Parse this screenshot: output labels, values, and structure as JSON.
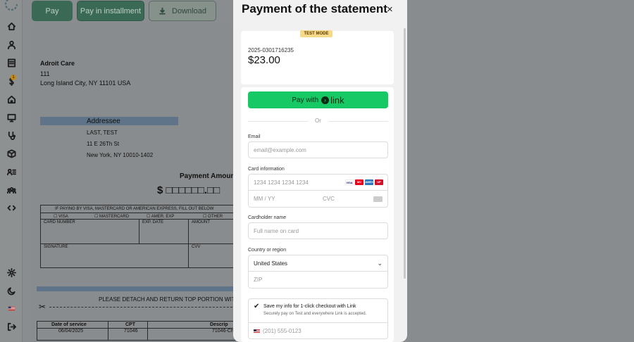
{
  "toolbar": {
    "pay_label": "Pay",
    "installment_label": "Pay in installment",
    "download_label": "Download"
  },
  "sidebar": {
    "badge_count": "1",
    "icons": [
      "home-icon",
      "user-icon",
      "document-icon",
      "dollar-icon",
      "house-icon",
      "monitor-icon",
      "stethoscope-icon",
      "box-icon",
      "user-list-icon",
      "group-icon",
      "code-icon",
      "settings-icon",
      "moon-icon",
      "us-flag-icon",
      "logout-icon"
    ]
  },
  "statement": {
    "company": "Adroit Care",
    "company_line2": "111",
    "company_line3": "Long Island City, NY 11101 USA",
    "addressee_header": "Addressee",
    "addressee_name": "LAST, TEST",
    "addressee_line2": "11 E 26Th St",
    "addressee_line3": "New York, NY 10010-1402",
    "payment_amount_label": "Payment Amoun",
    "amount_boxes": "$ □□□□□□.□□",
    "card_header": "IF PAYING BY VISA, MASTERCARD OR AMERICAN EXPRESS, FILL OUT BELOW",
    "card_visa": "☐ VISA",
    "card_mc": "☐ MASTERCARD",
    "card_amex": "☐ AMER. EXP",
    "card_other": "☐ OTHER",
    "card_number": "CARD NUMBER",
    "exp_date": "EXP. DATE",
    "amount": "AMOUNT",
    "signature": "SIGNATURE",
    "cvv": "CVV",
    "detach": "PLEASE DETACH AND RETURN TOP PORTION WITH YO",
    "col_date": "Date of service",
    "col_cpt": "CPT",
    "col_desc": "Descrip",
    "row_date": "06/04/2025",
    "row_cpt": "71046",
    "row_desc": "71046-Ch"
  },
  "modal": {
    "title": "Payment of the statement",
    "close": "×",
    "test_mode": "TEST MODE",
    "invoice_no": "2025-0301716235",
    "amount": "$23.00",
    "link_prefix": "Pay with",
    "link_word": "link",
    "or": "Or",
    "email_label": "Email",
    "email_placeholder": "email@example.com",
    "card_label": "Card information",
    "card_placeholder": "1234 1234 1234 1234",
    "expiry_placeholder": "MM / YY",
    "cvc_placeholder": "CVC",
    "cardholder_label": "Cardholder name",
    "cardholder_placeholder": "Full name on card",
    "country_label": "Country or region",
    "country_value": "United States",
    "zip_placeholder": "ZIP",
    "save_title": "Save my info for 1-click checkout with Link",
    "save_sub": "Securely pay on Test and everywhere Link is accepted.",
    "phone_placeholder": "(201) 555-0123",
    "brands": [
      "VISA",
      "MC",
      "AMEX",
      "UP"
    ],
    "link_color": "#17c964"
  }
}
